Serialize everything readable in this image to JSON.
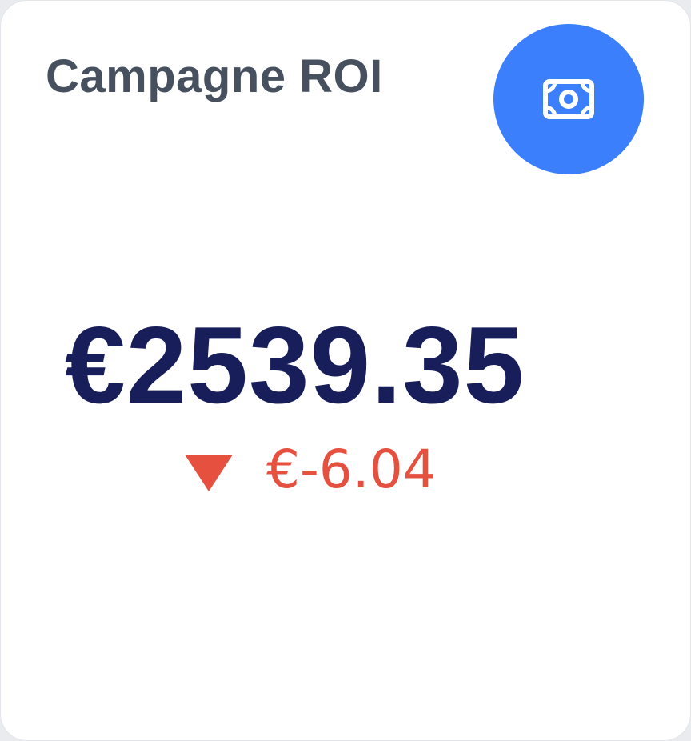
{
  "card": {
    "title": "Campagne ROI",
    "icon": "cash-icon",
    "value": "€2539.35",
    "change": {
      "direction": "down",
      "icon": "triangle-down-icon",
      "value": "€-6.04"
    }
  },
  "colors": {
    "accent": "#3b7ffc",
    "title": "#47505f",
    "value": "#171e5a",
    "negative": "#e5503f"
  }
}
